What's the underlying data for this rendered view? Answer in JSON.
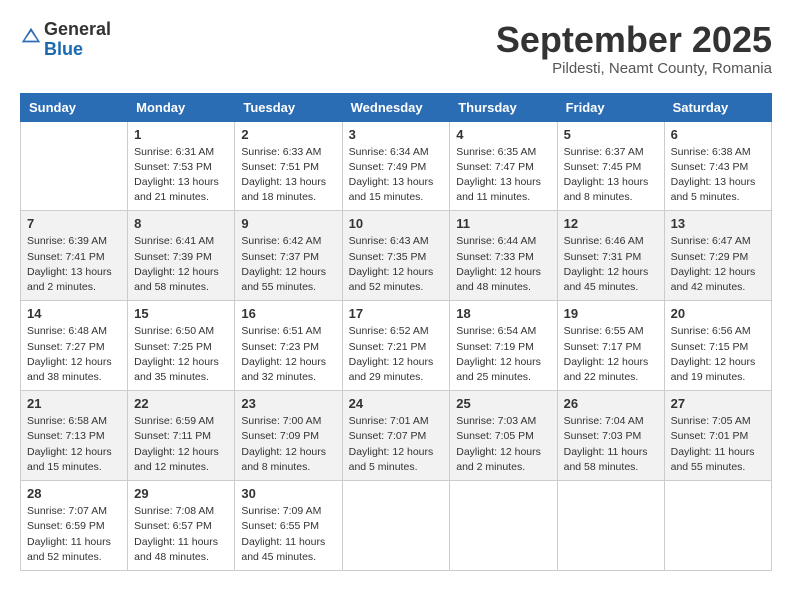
{
  "header": {
    "logo_general": "General",
    "logo_blue": "Blue",
    "month_title": "September 2025",
    "location": "Pildesti, Neamt County, Romania"
  },
  "days_of_week": [
    "Sunday",
    "Monday",
    "Tuesday",
    "Wednesday",
    "Thursday",
    "Friday",
    "Saturday"
  ],
  "weeks": [
    [
      {
        "day": "",
        "info": ""
      },
      {
        "day": "1",
        "info": "Sunrise: 6:31 AM\nSunset: 7:53 PM\nDaylight: 13 hours\nand 21 minutes."
      },
      {
        "day": "2",
        "info": "Sunrise: 6:33 AM\nSunset: 7:51 PM\nDaylight: 13 hours\nand 18 minutes."
      },
      {
        "day": "3",
        "info": "Sunrise: 6:34 AM\nSunset: 7:49 PM\nDaylight: 13 hours\nand 15 minutes."
      },
      {
        "day": "4",
        "info": "Sunrise: 6:35 AM\nSunset: 7:47 PM\nDaylight: 13 hours\nand 11 minutes."
      },
      {
        "day": "5",
        "info": "Sunrise: 6:37 AM\nSunset: 7:45 PM\nDaylight: 13 hours\nand 8 minutes."
      },
      {
        "day": "6",
        "info": "Sunrise: 6:38 AM\nSunset: 7:43 PM\nDaylight: 13 hours\nand 5 minutes."
      }
    ],
    [
      {
        "day": "7",
        "info": "Sunrise: 6:39 AM\nSunset: 7:41 PM\nDaylight: 13 hours\nand 2 minutes."
      },
      {
        "day": "8",
        "info": "Sunrise: 6:41 AM\nSunset: 7:39 PM\nDaylight: 12 hours\nand 58 minutes."
      },
      {
        "day": "9",
        "info": "Sunrise: 6:42 AM\nSunset: 7:37 PM\nDaylight: 12 hours\nand 55 minutes."
      },
      {
        "day": "10",
        "info": "Sunrise: 6:43 AM\nSunset: 7:35 PM\nDaylight: 12 hours\nand 52 minutes."
      },
      {
        "day": "11",
        "info": "Sunrise: 6:44 AM\nSunset: 7:33 PM\nDaylight: 12 hours\nand 48 minutes."
      },
      {
        "day": "12",
        "info": "Sunrise: 6:46 AM\nSunset: 7:31 PM\nDaylight: 12 hours\nand 45 minutes."
      },
      {
        "day": "13",
        "info": "Sunrise: 6:47 AM\nSunset: 7:29 PM\nDaylight: 12 hours\nand 42 minutes."
      }
    ],
    [
      {
        "day": "14",
        "info": "Sunrise: 6:48 AM\nSunset: 7:27 PM\nDaylight: 12 hours\nand 38 minutes."
      },
      {
        "day": "15",
        "info": "Sunrise: 6:50 AM\nSunset: 7:25 PM\nDaylight: 12 hours\nand 35 minutes."
      },
      {
        "day": "16",
        "info": "Sunrise: 6:51 AM\nSunset: 7:23 PM\nDaylight: 12 hours\nand 32 minutes."
      },
      {
        "day": "17",
        "info": "Sunrise: 6:52 AM\nSunset: 7:21 PM\nDaylight: 12 hours\nand 29 minutes."
      },
      {
        "day": "18",
        "info": "Sunrise: 6:54 AM\nSunset: 7:19 PM\nDaylight: 12 hours\nand 25 minutes."
      },
      {
        "day": "19",
        "info": "Sunrise: 6:55 AM\nSunset: 7:17 PM\nDaylight: 12 hours\nand 22 minutes."
      },
      {
        "day": "20",
        "info": "Sunrise: 6:56 AM\nSunset: 7:15 PM\nDaylight: 12 hours\nand 19 minutes."
      }
    ],
    [
      {
        "day": "21",
        "info": "Sunrise: 6:58 AM\nSunset: 7:13 PM\nDaylight: 12 hours\nand 15 minutes."
      },
      {
        "day": "22",
        "info": "Sunrise: 6:59 AM\nSunset: 7:11 PM\nDaylight: 12 hours\nand 12 minutes."
      },
      {
        "day": "23",
        "info": "Sunrise: 7:00 AM\nSunset: 7:09 PM\nDaylight: 12 hours\nand 8 minutes."
      },
      {
        "day": "24",
        "info": "Sunrise: 7:01 AM\nSunset: 7:07 PM\nDaylight: 12 hours\nand 5 minutes."
      },
      {
        "day": "25",
        "info": "Sunrise: 7:03 AM\nSunset: 7:05 PM\nDaylight: 12 hours\nand 2 minutes."
      },
      {
        "day": "26",
        "info": "Sunrise: 7:04 AM\nSunset: 7:03 PM\nDaylight: 11 hours\nand 58 minutes."
      },
      {
        "day": "27",
        "info": "Sunrise: 7:05 AM\nSunset: 7:01 PM\nDaylight: 11 hours\nand 55 minutes."
      }
    ],
    [
      {
        "day": "28",
        "info": "Sunrise: 7:07 AM\nSunset: 6:59 PM\nDaylight: 11 hours\nand 52 minutes."
      },
      {
        "day": "29",
        "info": "Sunrise: 7:08 AM\nSunset: 6:57 PM\nDaylight: 11 hours\nand 48 minutes."
      },
      {
        "day": "30",
        "info": "Sunrise: 7:09 AM\nSunset: 6:55 PM\nDaylight: 11 hours\nand 45 minutes."
      },
      {
        "day": "",
        "info": ""
      },
      {
        "day": "",
        "info": ""
      },
      {
        "day": "",
        "info": ""
      },
      {
        "day": "",
        "info": ""
      }
    ]
  ]
}
